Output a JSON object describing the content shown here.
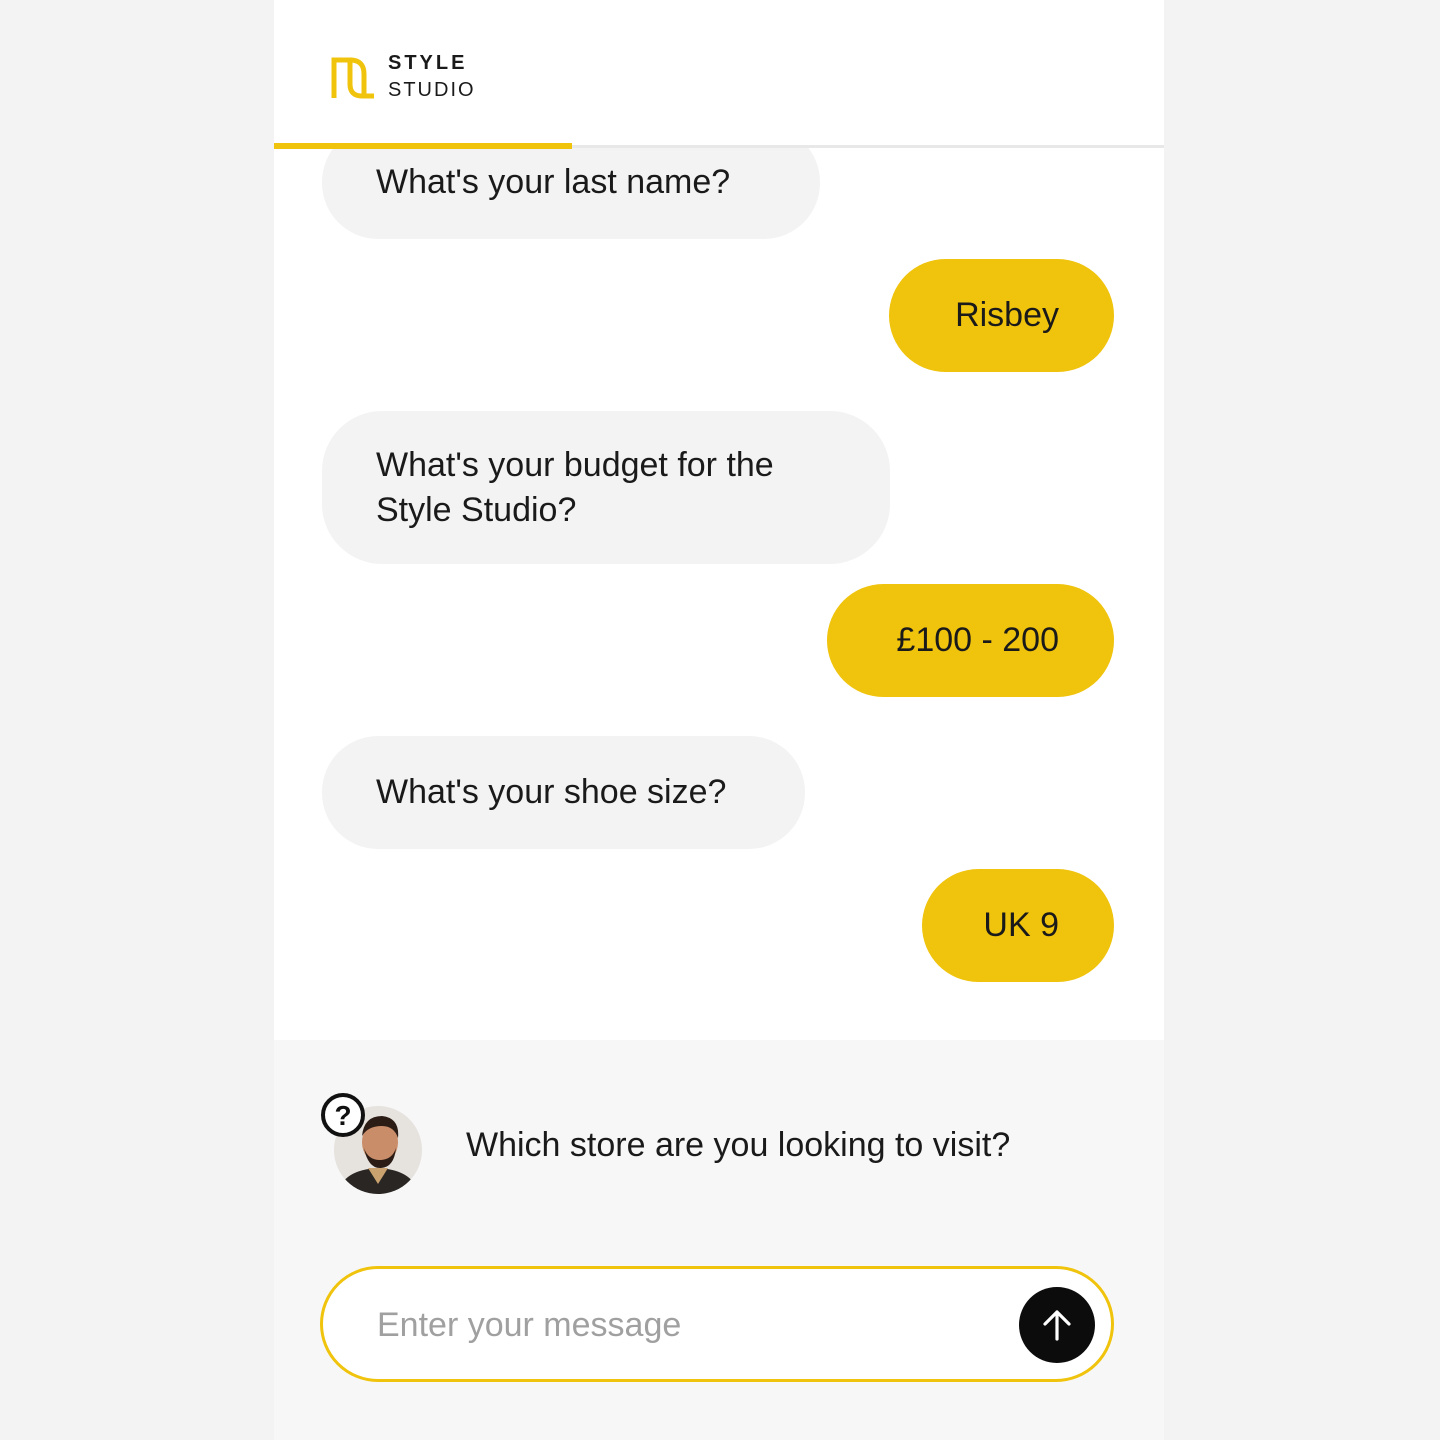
{
  "brand": {
    "line1": "STYLE",
    "line2": "STUDIO",
    "accent_color": "#f0c30c"
  },
  "progress": {
    "fraction": 0.335
  },
  "messages": [
    {
      "from": "bot",
      "text": "What's your last name?"
    },
    {
      "from": "user",
      "text": "Risbey"
    },
    {
      "from": "bot",
      "text": "What's your budget for the Style Studio?"
    },
    {
      "from": "user",
      "text": "£100 - 200"
    },
    {
      "from": "bot",
      "text": "What's your shoe size?"
    },
    {
      "from": "user",
      "text": "UK 9"
    }
  ],
  "footer": {
    "agent_icon": "help-question-icon",
    "question": "Which store are you looking to visit?",
    "input_placeholder": "Enter your message",
    "input_value": "",
    "send_icon": "arrow-up-icon"
  }
}
